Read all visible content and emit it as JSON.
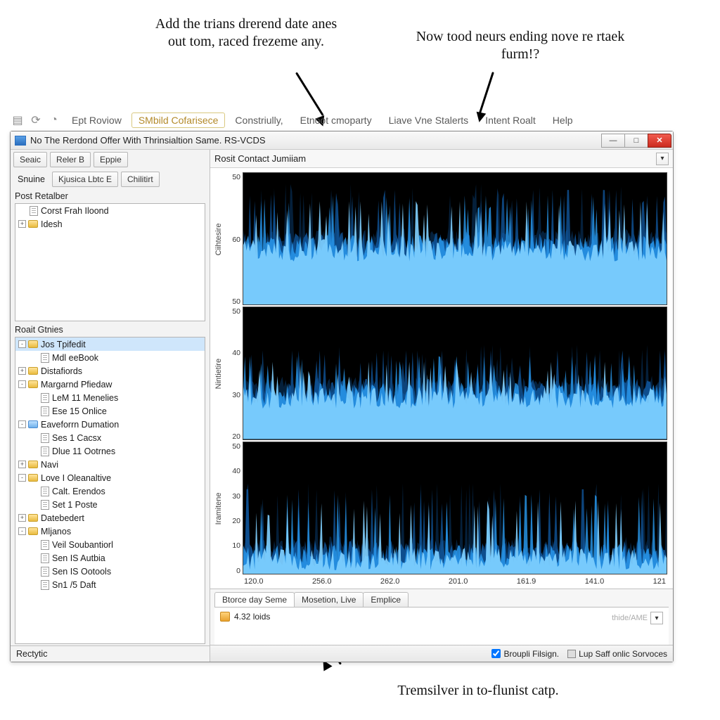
{
  "callouts": {
    "left": "Add the trians drerend date anes out tom, raced frezeme any.",
    "right": "Now tood neurs ending nove re rtaek furm!?",
    "bottom": "Tremsilver in to-flunist catp."
  },
  "appbar": {
    "items": [
      {
        "label": "Ept Roviow",
        "active": false
      },
      {
        "label": "SMbild Cofarisece",
        "active": true
      },
      {
        "label": "Constriully,",
        "active": false
      },
      {
        "label": "Etnoot cmoparty",
        "active": false
      },
      {
        "label": "Liave Vne Stalerts",
        "active": false
      },
      {
        "label": "Intent Roalt",
        "active": false
      },
      {
        "label": "Help",
        "active": false
      }
    ]
  },
  "window": {
    "title": "No The Rerdond Offer With Thrinsialtion Same. RS-VCDS"
  },
  "sidebar": {
    "row1": [
      "Seaic",
      "Reler B",
      "Eppie"
    ],
    "row2_label": "Snuine",
    "row2": [
      "Kjusica Lbtc E",
      "Chilitirt"
    ],
    "top_label": "Post Retalber",
    "top_tree": [
      {
        "depth": 0,
        "icon": "doc",
        "label": "Corst Frah Iloond",
        "toggle": ""
      },
      {
        "depth": 0,
        "icon": "folder",
        "label": "Idesh",
        "toggle": "+"
      }
    ],
    "bottom_label": "Roait Gtnies",
    "bottom_tree": [
      {
        "depth": 0,
        "icon": "folder",
        "label": "Jos Tpifedit",
        "toggle": "-",
        "selected": true
      },
      {
        "depth": 1,
        "icon": "doc",
        "label": "Mdl eeBook"
      },
      {
        "depth": 0,
        "icon": "folder",
        "label": "Distafiords",
        "toggle": "+"
      },
      {
        "depth": 0,
        "icon": "folder",
        "label": "Margarnd Pfiedaw",
        "toggle": "-"
      },
      {
        "depth": 1,
        "icon": "doc",
        "label": "LeM 11 Menelies"
      },
      {
        "depth": 1,
        "icon": "doc",
        "label": "Ese 15 Onlice"
      },
      {
        "depth": 0,
        "icon": "folder-blue",
        "label": "Eaveforrn Dumation",
        "toggle": "-"
      },
      {
        "depth": 1,
        "icon": "doc",
        "label": "Ses 1 Cacsx"
      },
      {
        "depth": 1,
        "icon": "doc",
        "label": "Dlue 11 Ootrnes"
      },
      {
        "depth": 0,
        "icon": "folder",
        "label": "Navi",
        "toggle": "+"
      },
      {
        "depth": 0,
        "icon": "folder",
        "label": "Love I Oleanaltive",
        "toggle": "-"
      },
      {
        "depth": 1,
        "icon": "doc",
        "label": "Calt. Erendos"
      },
      {
        "depth": 1,
        "icon": "doc",
        "label": "Set 1 Poste"
      },
      {
        "depth": 0,
        "icon": "folder",
        "label": "Datebedert",
        "toggle": "+"
      },
      {
        "depth": 0,
        "icon": "folder",
        "label": "Mljanos",
        "toggle": "-"
      },
      {
        "depth": 1,
        "icon": "doc",
        "label": "Veil Soubantiorl"
      },
      {
        "depth": 1,
        "icon": "doc",
        "label": "Sen IS Autbia"
      },
      {
        "depth": 1,
        "icon": "doc",
        "label": "Sen IS Ootools"
      },
      {
        "depth": 1,
        "icon": "doc",
        "label": "Sn1 /5 Daft"
      }
    ],
    "footer": "Rectytic"
  },
  "chart": {
    "header": "Rosit Contact Jumiiam",
    "xticks": [
      "120.0",
      "256.0",
      "262.0",
      "201.0",
      "161.9",
      "141.0",
      "121"
    ]
  },
  "chart_data": [
    {
      "type": "line",
      "ylabel": "Ciihtesire",
      "yticks": [
        50,
        60,
        50
      ],
      "ylim": [
        0,
        70
      ],
      "note": "dense noisy waveform, baseline ~35, peaks up to ~65"
    },
    {
      "type": "line",
      "ylabel": "Nintietire",
      "yticks": [
        50,
        40,
        30,
        20
      ],
      "ylim": [
        15,
        55
      ],
      "note": "dense noisy waveform, baseline ~28, peaks up to ~50"
    },
    {
      "type": "line",
      "ylabel": "Iramitene",
      "yticks": [
        50,
        40,
        30,
        20,
        10,
        0
      ],
      "ylim": [
        0,
        55
      ],
      "note": "dense noisy waveform, baseline ~12, peaks up to ~48"
    }
  ],
  "bottom_tabs": {
    "tabs": [
      {
        "label": "Btorce day Seme",
        "active": true
      },
      {
        "label": "Mosetion, Live",
        "active": false
      },
      {
        "label": "Emplice",
        "active": false
      }
    ],
    "body_text": "4.32 loids",
    "right_hint": "thide/AME"
  },
  "statusbar": {
    "check1": "Broupli Filsign.",
    "check2": "Lup Saff onlic Sorvoces"
  }
}
